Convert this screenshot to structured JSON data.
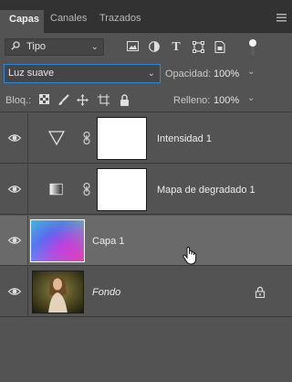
{
  "tabs": [
    {
      "label": "Capas",
      "active": true
    },
    {
      "label": "Canales",
      "active": false
    },
    {
      "label": "Trazados",
      "active": false
    }
  ],
  "panel_menu_icon": "hamburger-icon",
  "filter": {
    "selected": "Tipo",
    "icons": [
      "image-filter-icon",
      "adjustment-filter-icon",
      "type-filter-icon",
      "shape-filter-icon",
      "smart-object-filter-icon",
      "filter-toggle-icon"
    ]
  },
  "blend": {
    "selected": "Luz suave",
    "opacity_label": "Opacidad:",
    "opacity_value": "100%"
  },
  "lock": {
    "label": "Bloq.:",
    "icons": [
      "lock-transparent-icon",
      "lock-image-icon",
      "lock-position-icon",
      "artboard-icon",
      "lock-all-icon"
    ],
    "fill_label": "Relleno:",
    "fill_value": "100%"
  },
  "layers": [
    {
      "name": "Intensidad 1",
      "type": "adjustment",
      "icon": "vibrance-icon",
      "visible": true,
      "selected": false,
      "italic": false
    },
    {
      "name": "Mapa de degradado 1",
      "type": "adjustment",
      "icon": "gradient-map-icon",
      "visible": true,
      "selected": false,
      "italic": false
    },
    {
      "name": "Capa 1",
      "type": "pixel",
      "visible": true,
      "selected": true,
      "italic": false
    },
    {
      "name": "Fondo",
      "type": "background",
      "visible": true,
      "selected": false,
      "italic": true,
      "locked": true
    }
  ],
  "colors": {
    "panel_bg": "#535353",
    "tabbar_bg": "#323232",
    "selected_row": "#6a6a6a",
    "focus_border": "#2f86d6"
  }
}
